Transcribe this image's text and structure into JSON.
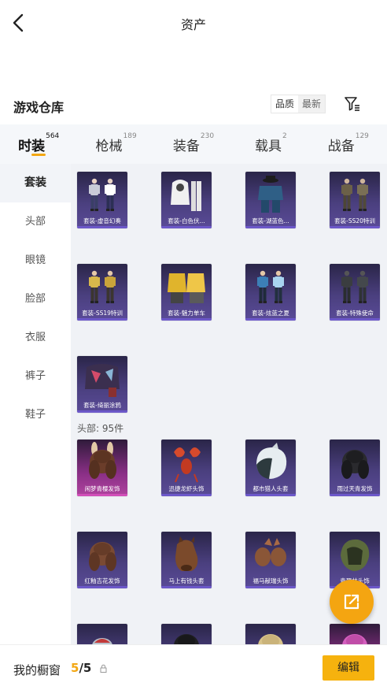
{
  "header": {
    "title": "资产"
  },
  "warehouse": {
    "title": "游戏仓库",
    "sort_options": [
      "品质",
      "最新"
    ]
  },
  "tabs": [
    {
      "label": "时装",
      "count": "564"
    },
    {
      "label": "枪械",
      "count": "189"
    },
    {
      "label": "装备",
      "count": "230"
    },
    {
      "label": "载具",
      "count": "2"
    },
    {
      "label": "战备",
      "count": "129"
    }
  ],
  "sidebar": {
    "items": [
      "套装",
      "头部",
      "眼镜",
      "脸部",
      "衣服",
      "裤子",
      "鞋子"
    ]
  },
  "suits": [
    {
      "name": "套装-虚音幻奏",
      "icon": "outfit-twin-figures"
    },
    {
      "name": "套装-白色伏...",
      "icon": "outfit-hoodie-pants"
    },
    {
      "name": "套装-湖蓝色...",
      "icon": "outfit-suit-hat"
    },
    {
      "name": "套装-SS20特训",
      "icon": "outfit-twin-soldiers"
    },
    {
      "name": "套装-SS19特训",
      "icon": "outfit-twin-yellow"
    },
    {
      "name": "套装-魅力单车",
      "icon": "outfit-yellow-shirt"
    },
    {
      "name": "套装-炫蓝之夏",
      "icon": "outfit-twin-blue"
    },
    {
      "name": "套装-特殊使命",
      "icon": "outfit-dark-tactical"
    },
    {
      "name": "套装-绮丽涂鸦",
      "icon": "outfit-graffiti-jacket"
    }
  ],
  "head_section": {
    "label": "头部: 95件"
  },
  "heads": [
    {
      "name": "闲梦青樱发饰",
      "icon": "hair-bunny",
      "rarity": "pink"
    },
    {
      "name": "迅捷龙虾头饰",
      "icon": "lobster-head",
      "rarity": "purple"
    },
    {
      "name": "都市猎人头套",
      "icon": "hunter-mask",
      "rarity": "purple"
    },
    {
      "name": "雨过天青发饰",
      "icon": "dark-hair",
      "rarity": "purple"
    },
    {
      "name": "红釉吉花发饰",
      "icon": "brown-hair",
      "rarity": "purple"
    },
    {
      "name": "马上有钱头套",
      "icon": "horse-mask",
      "rarity": "purple"
    },
    {
      "name": "福马献瑞头饰",
      "icon": "horse-headband",
      "rarity": "purple"
    },
    {
      "name": "青翠林头饰",
      "icon": "green-hood",
      "rarity": "purple"
    },
    {
      "name": "",
      "icon": "red-hat",
      "rarity": "purple"
    },
    {
      "name": "",
      "icon": "black-hair",
      "rarity": "purple"
    },
    {
      "name": "",
      "icon": "blonde-hair",
      "rarity": "purple"
    },
    {
      "name": "",
      "icon": "pink-hair",
      "rarity": "pink"
    }
  ],
  "showcase": {
    "label": "我的橱窗",
    "current": "5",
    "separator": "/",
    "total": "5"
  },
  "edit_label": "编辑",
  "colors": {
    "accent": "#f3a712",
    "card_purple": "#4a3f7e",
    "card_pink": "#b0449f"
  }
}
